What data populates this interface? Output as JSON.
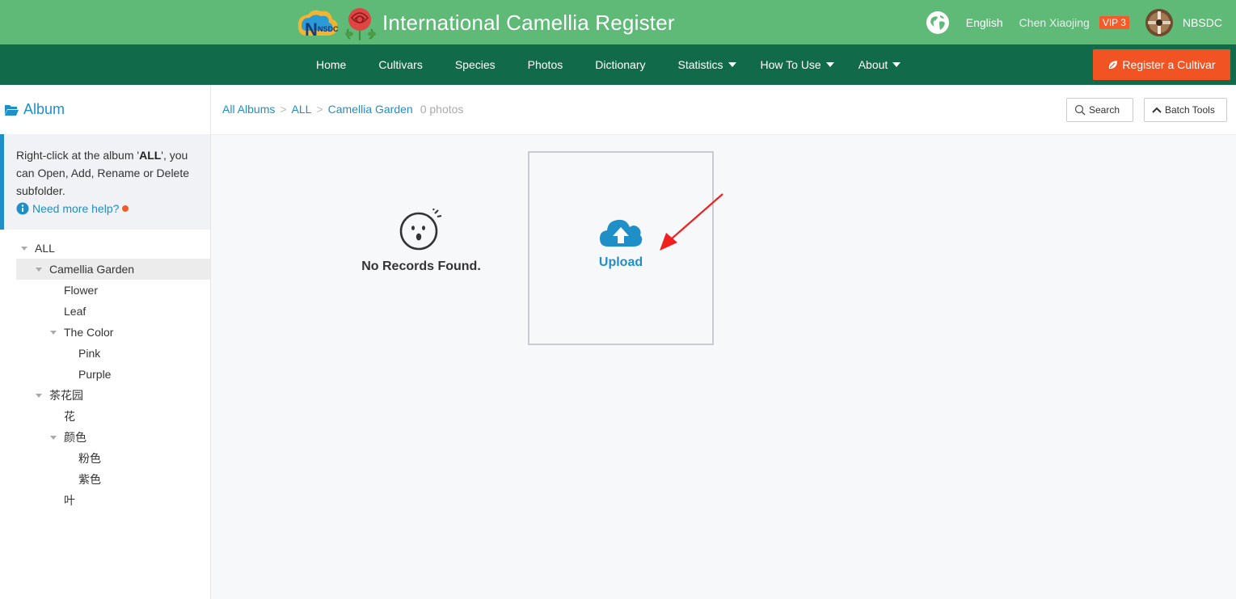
{
  "header": {
    "logo_text": "NSDC",
    "title": "International Camellia Register",
    "language": "English",
    "user_name": "Chen Xiaojing",
    "vip_badge": "VIP 3",
    "org_name": "NBSDC"
  },
  "nav": {
    "items": [
      {
        "label": "Home"
      },
      {
        "label": "Cultivars"
      },
      {
        "label": "Species"
      },
      {
        "label": "Photos"
      },
      {
        "label": "Dictionary"
      },
      {
        "label": "Statistics",
        "dropdown": true
      },
      {
        "label": "How To Use",
        "dropdown": true
      },
      {
        "label": "About",
        "dropdown": true
      }
    ],
    "register_label": "Register a Cultivar"
  },
  "sidebar": {
    "title": "Album",
    "tip": {
      "part1": "Right-click at the album '",
      "strong": "ALL",
      "part2": "', you can Open, Add, Rename or Delete subfolder.",
      "help_link": "Need more help?"
    },
    "tree": [
      {
        "label": "ALL",
        "level": 0,
        "expanded": true
      },
      {
        "label": "Camellia Garden",
        "level": 1,
        "expanded": true,
        "active": true
      },
      {
        "label": "Flower",
        "level": 2
      },
      {
        "label": "Leaf",
        "level": 2
      },
      {
        "label": "The Color",
        "level": 2,
        "expanded": true
      },
      {
        "label": "Pink",
        "level": 3
      },
      {
        "label": "Purple",
        "level": 3
      },
      {
        "label": "茶花园",
        "level": 1,
        "expanded": true
      },
      {
        "label": "花",
        "level": 2
      },
      {
        "label": "颜色",
        "level": 2,
        "expanded": true
      },
      {
        "label": "粉色",
        "level": 3
      },
      {
        "label": "紫色",
        "level": 3
      },
      {
        "label": "叶",
        "level": 2
      }
    ]
  },
  "main": {
    "breadcrumb": [
      "All Albums",
      "ALL",
      "Camellia Garden"
    ],
    "breadcrumb_sep": ">",
    "photo_count": "0 photos",
    "search_label": "Search",
    "batch_label": "Batch Tools",
    "empty_text": "No Records Found.",
    "upload_label": "Upload"
  },
  "colors": {
    "header_green": "#5fb977",
    "nav_dark_green": "#116b4a",
    "accent_orange": "#f15322",
    "link_blue": "#1e8fc7"
  },
  "icons": [
    "nsdc-logo-icon",
    "camellia-rose-logo-icon",
    "globe-icon",
    "avatar",
    "leaf-icon",
    "folder-open-icon",
    "info-icon",
    "search-icon",
    "chevron-up-icon",
    "surprised-face-icon",
    "cloud-upload-icon",
    "red-arrow-annotation"
  ]
}
